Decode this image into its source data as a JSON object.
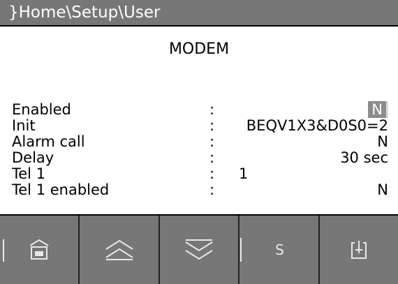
{
  "header": {
    "path": "}Home\\Setup\\User"
  },
  "screen": {
    "title": "MODEM"
  },
  "fields": [
    {
      "label": "Enabled",
      "sep": ":",
      "value": "N"
    },
    {
      "label": "Init",
      "sep": ":",
      "value": "BEQV1X3&D0S0=2"
    },
    {
      "label": "Alarm call",
      "sep": ":",
      "value": "N"
    },
    {
      "label": "Delay",
      "sep": ":",
      "value": "30 sec"
    },
    {
      "label": "Tel 1",
      "sep": ":",
      "value": "1"
    },
    {
      "label": "Tel 1 enabled",
      "sep": ":",
      "value": "N"
    }
  ],
  "toolbar": {
    "buttons": [
      {
        "icon": "home-icon"
      },
      {
        "icon": "page-up-icon"
      },
      {
        "icon": "page-down-icon"
      },
      {
        "icon": "s-key",
        "label": "S"
      },
      {
        "icon": "exit-icon"
      }
    ]
  },
  "colors": {
    "bar_gray": "#777777",
    "edit_highlight": "#8c8c8c",
    "icon_light": "#e8e8e8"
  }
}
